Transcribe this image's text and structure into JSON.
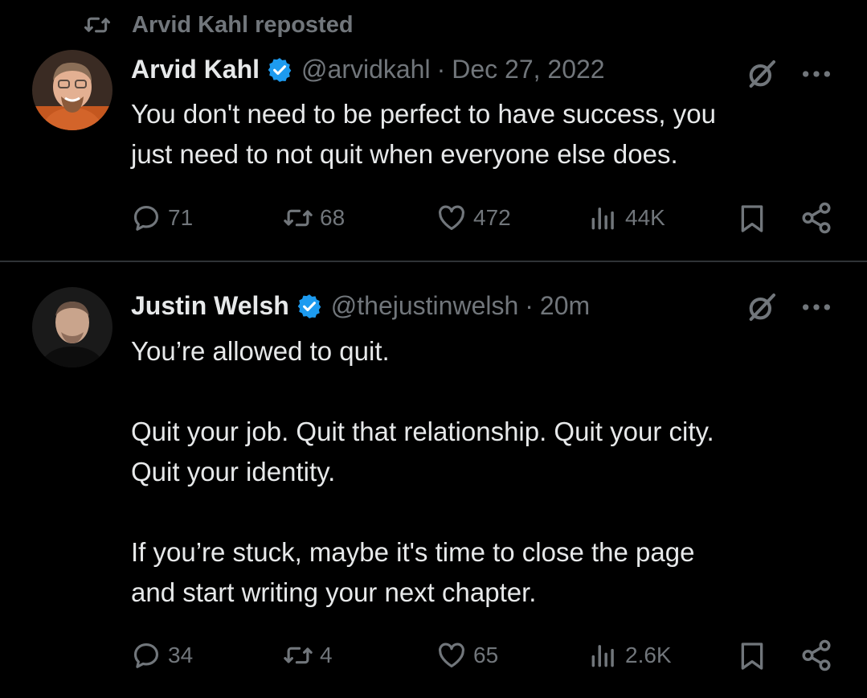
{
  "repost": {
    "label": "Arvid Kahl reposted"
  },
  "tweets": [
    {
      "author": "Arvid Kahl",
      "handle": "@arvidkahl",
      "time": "Dec 27, 2022",
      "text": "You don't need to be perfect to have success, you\njust need to not quit when everyone else does.",
      "replies": "71",
      "reposts": "68",
      "likes": "472",
      "views": "44K"
    },
    {
      "author": "Justin Welsh",
      "handle": "@thejustinwelsh",
      "time": "20m",
      "text": "You’re allowed to quit.\n\nQuit your job. Quit that relationship. Quit your city.\nQuit your identity.\n\nIf you’re stuck, maybe it's time to close the page\nand start writing your next chapter.",
      "replies": "34",
      "reposts": "4",
      "likes": "65",
      "views": "2.6K"
    }
  ],
  "meta": {
    "separator": "·"
  },
  "colors": {
    "verified": "#1d9bf0",
    "muted": "#71767b",
    "text": "#e7e9ea"
  },
  "icons": [
    "repost-icon",
    "verified-badge-icon",
    "grok-icon",
    "more-icon",
    "reply-icon",
    "like-icon",
    "views-icon",
    "bookmark-icon",
    "share-icon"
  ]
}
